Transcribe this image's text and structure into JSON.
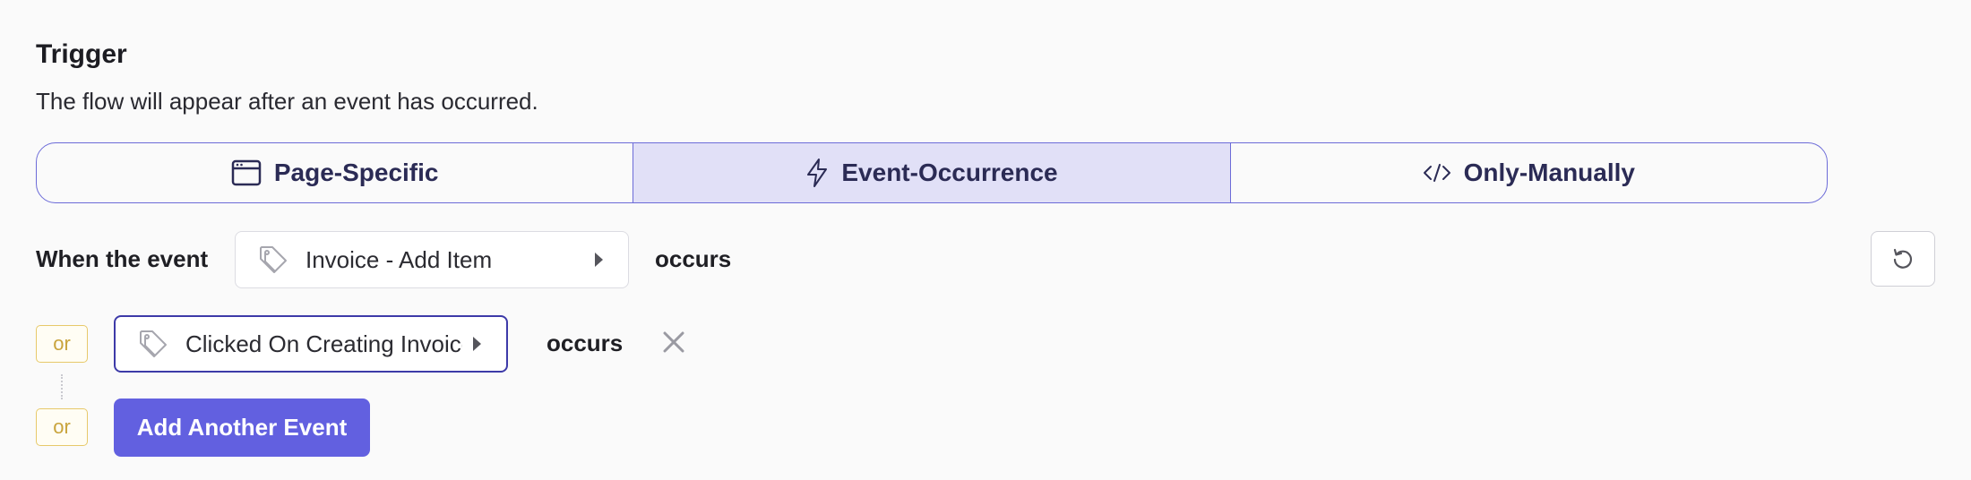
{
  "trigger": {
    "title": "Trigger",
    "description": "The flow will appear after an event has occurred."
  },
  "modes": [
    {
      "label": "Page-Specific",
      "icon": "browser-window-icon",
      "active": false
    },
    {
      "label": "Event-Occurrence",
      "icon": "lightning-icon",
      "active": true
    },
    {
      "label": "Only-Manually",
      "icon": "code-icon",
      "active": false
    }
  ],
  "condition": {
    "when_label": "When the event",
    "occurs_label": "occurs",
    "or_label": "or",
    "events": [
      {
        "label": "Invoice - Add Item",
        "icon": "tag-icon"
      },
      {
        "label": "Clicked On Creating Invoice",
        "icon": "tag-icon"
      }
    ],
    "add_event_label": "Add Another Event"
  },
  "colors": {
    "accent": "#6260e0",
    "accent_border": "#6c6bd8",
    "active_segment": "#e1e0f7",
    "or_chip": "#e7c96a"
  }
}
